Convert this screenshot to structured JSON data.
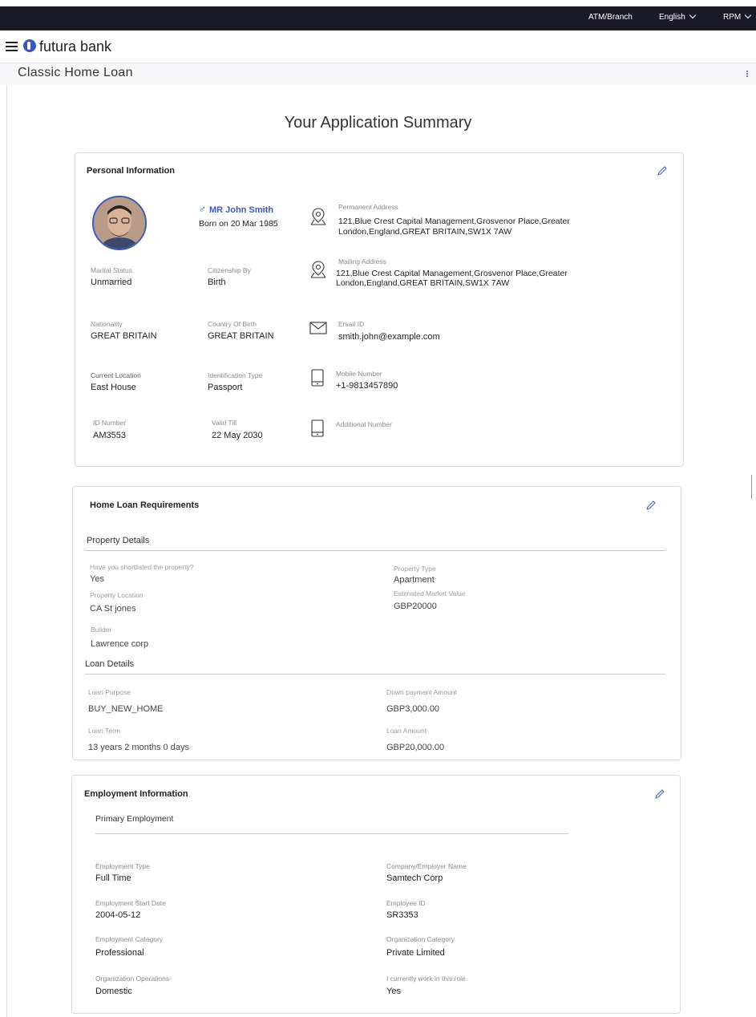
{
  "topbar": {
    "atm_branch": "ATM/Branch",
    "language": "English",
    "user": "RPM"
  },
  "brand": {
    "name": "futura bank"
  },
  "page": {
    "title": "Classic Home Loan",
    "summary_title": "Your Application Summary"
  },
  "personal": {
    "title": "Personal Information",
    "name": "MR John Smith",
    "gender_symbol": "♂",
    "born": "Born on 20 Mar 1985",
    "permanent_address_label": "Permanent Address",
    "permanent_address_line1": "121,Blue Crest Capital Management,Grosvenor Place,Greater",
    "permanent_address_line2": "London,England,GREAT BRITAIN,SW1X 7AW",
    "mailing_address_label": "Mailing Address",
    "mailing_address_line1": "121,Blue Crest Capital Management,Grosvenor Place,Greater",
    "mailing_address_line2": "London,England,GREAT BRITAIN,SW1X 7AW",
    "email_label": "Email ID",
    "email": "smith.john@example.com",
    "mobile_label": "Mobile Number",
    "mobile": "+1-9813457890",
    "additional_label": "Additional Number",
    "marital_status_label": "Marital Status",
    "marital_status": "Unmarried",
    "citizenship_label": "Citizenship By",
    "citizenship": "Birth",
    "nationality_label": "Nationality",
    "nationality": "GREAT BRITAIN",
    "country_birth_label": "Country Of Birth",
    "country_birth": "GREAT BRITAIN",
    "current_location_label": "Current Location",
    "current_location": "East House",
    "id_type_label": "Identification Type",
    "id_type": "Passport",
    "id_number_label": "ID Number",
    "id_number": "AM3553",
    "valid_till_label": "Valid Till",
    "valid_till": "22 May 2030"
  },
  "home_loan": {
    "title": "Home Loan Requirements",
    "property_details": "Property Details",
    "shortlisted_label": "Have you shortlisted the property?",
    "shortlisted": "Yes",
    "property_type_label": "Property Type",
    "property_type": "Apartment",
    "property_location_label": "Property Location",
    "property_location": "CA St jones",
    "market_value_label": "Estimated Market Value",
    "market_value": "GBP20000",
    "builder_label": "Builder",
    "builder": "Lawrence corp",
    "loan_details": "Loan Details",
    "loan_purpose_label": "Loan Purpose",
    "loan_purpose": "BUY_NEW_HOME",
    "down_payment_label": "Down payment Amount",
    "down_payment": "GBP3,000.00",
    "loan_term_label": "Loan Term",
    "loan_term": "13 years 2 months 0 days",
    "loan_amount_label": "Loan Amount",
    "loan_amount": "GBP20,000.00"
  },
  "employment": {
    "title": "Employment Information",
    "primary": "Primary Employment",
    "type_label": "Employment Type",
    "type": "Full Time",
    "employer_label": "Company/Employer Name",
    "employer": "Samtech Corp",
    "start_label": "Employment Start Date",
    "start": "2004-05-12",
    "emp_id_label": "Employee ID",
    "emp_id": "SR3353",
    "category_label": "Employment Category",
    "category": "Professional",
    "org_category_label": "Organization Category",
    "org_category": "Private Limited",
    "org_ops_label": "Organization Operations",
    "org_ops": "Domestic",
    "current_role_label": "I currently work in this role",
    "current_role": "Yes"
  }
}
